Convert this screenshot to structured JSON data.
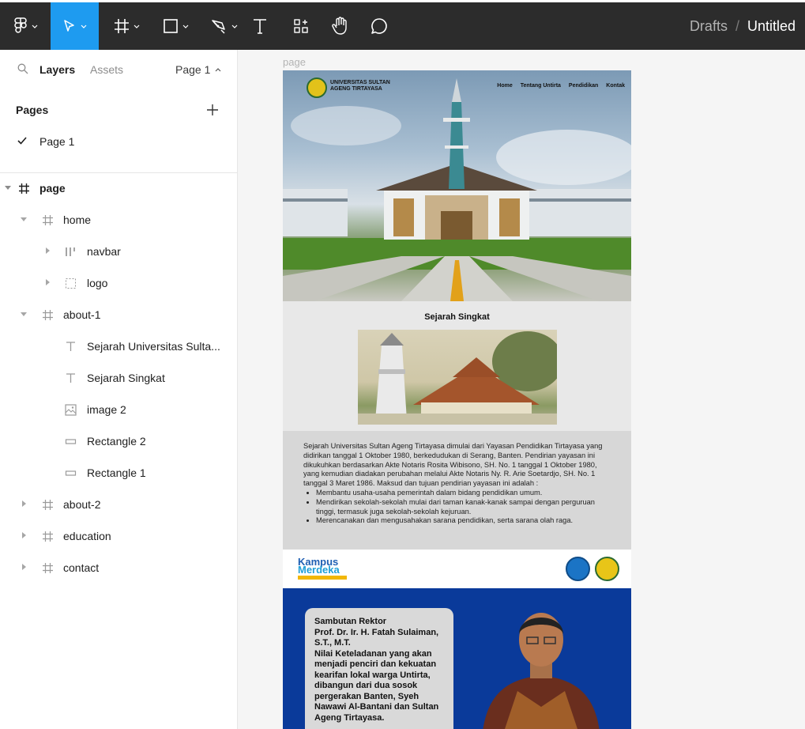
{
  "toolbar": {
    "breadcrumb_drafts": "Drafts",
    "breadcrumb_sep": "/",
    "file_name": "Untitled",
    "accent": "#1e9bf0"
  },
  "panel": {
    "tab_layers": "Layers",
    "tab_assets": "Assets",
    "page_selector": "Page 1",
    "pages_heading": "Pages",
    "pages": [
      "Page 1"
    ],
    "layers": [
      {
        "label": "page"
      },
      {
        "label": "home"
      },
      {
        "label": "navbar"
      },
      {
        "label": "logo"
      },
      {
        "label": "about-1"
      },
      {
        "label": "Sejarah Universitas Sulta..."
      },
      {
        "label": "Sejarah Singkat"
      },
      {
        "label": "image 2"
      },
      {
        "label": "Rectangle 2"
      },
      {
        "label": "Rectangle 1"
      },
      {
        "label": "about-2"
      },
      {
        "label": "education"
      },
      {
        "label": "contact"
      }
    ]
  },
  "canvas": {
    "frame_label": "page",
    "brand_line1": "UNIVERSITAS SULTAN",
    "brand_line2": "AGENG TIRTAYASA",
    "nav": [
      "Home",
      "Tentang Untirta",
      "Pendidikan",
      "Kontak"
    ],
    "about_title": "Sejarah Singkat",
    "about_paragraph": "Sejarah Universitas Sultan Ageng Tirtayasa dimulai dari Yayasan Pendidikan Tirtayasa yang didirikan tanggal 1 Oktober 1980, berkedudukan di Serang, Banten. Pendirian yayasan ini dikukuhkan berdasarkan Akte Notaris Rosita Wibisono, SH. No. 1 tanggal 1 Oktober 1980, yang kemudian diadakan perubahan melalui Akte Notaris Ny. R. Arie Soetardjo, SH. No. 1 tanggal 3 Maret 1986. Maksud dan tujuan pendirian yayasan ini adalah :",
    "about_bullets": [
      "Membantu usaha-usaha pemerintah dalam bidang pendidikan umum.",
      "Mendirikan sekolah-sekolah mulai dari taman kanak-kanak sampai dengan perguruan tinggi, termasuk juga sekolah-sekolah kejuruan.",
      "Merencanakan dan mengusahakan sarana pendidikan, serta sarana olah raga."
    ],
    "kampus_line1": "Kampus",
    "kampus_line2": "Merdeka",
    "card_lines": [
      "Sambutan Rektor",
      "Prof. Dr. Ir. H. Fatah Sulaiman, S.T., M.T.",
      "Nilai Keteladanan yang akan menjadi penciri dan kekuatan kearifan lokal warga Untirta, dibangun dari dua sosok pergerakan Banten, Syeh Nawawi Al-Bantani dan Sultan Ageng Tirtayasa."
    ]
  }
}
